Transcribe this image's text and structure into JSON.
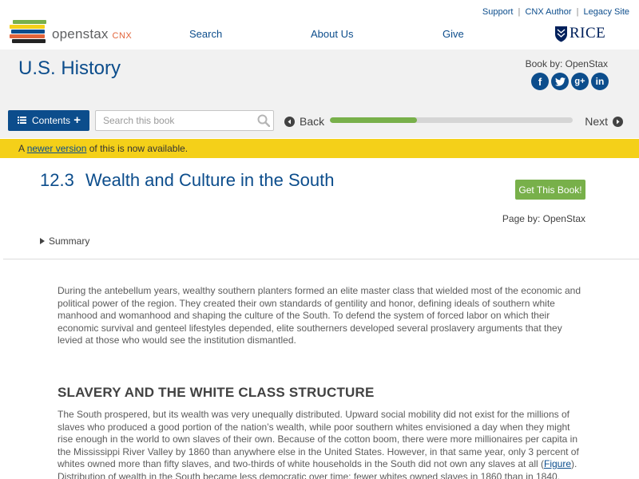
{
  "header": {
    "logo_text": "openstax",
    "logo_suffix": "CNX",
    "util_links": [
      "Support",
      "CNX Author",
      "Legacy Site"
    ],
    "nav": [
      "Search",
      "About Us",
      "Give"
    ],
    "partner_logo": "RICE",
    "logo_colors": [
      "#f4d019",
      "#78b04a",
      "#0c4d8c",
      "#e2643a",
      "#232323"
    ]
  },
  "book": {
    "title": "U.S. History",
    "book_by": "Book by: OpenStax",
    "social": [
      "f",
      "t",
      "g+",
      "in"
    ],
    "social_icons": [
      "facebook-icon",
      "twitter-icon",
      "google-plus-icon",
      "linkedin-icon"
    ]
  },
  "toolbar": {
    "contents_label": "Contents",
    "search_placeholder": "Search this book",
    "back_label": "Back",
    "next_label": "Next",
    "progress": 0.36
  },
  "notice": {
    "prefix": "A ",
    "link": "newer version",
    "suffix": " of this is now available."
  },
  "section": {
    "number": "12.3",
    "title": "Wealth and Culture in the South",
    "get_book": "Get This Book!",
    "page_by": "Page by: OpenStax",
    "summary": "Summary"
  },
  "content": {
    "intro": "During the antebellum years, wealthy southern planters formed an elite master class that wielded most of the economic and political power of the region. They created their own standards of gentility and honor, defining ideals of southern white manhood and womanhood and shaping the culture of the South. To defend the system of forced labor on which their economic survival and genteel lifestyles depended, elite southerners developed several proslavery arguments that they levied at those who would see the institution dismantled.",
    "heading": "SLAVERY AND THE WHITE CLASS STRUCTURE",
    "p2_a": "The South prospered, but its wealth was very unequally distributed. Upward social mobility did not exist for the millions of slaves who produced a good portion of the nation’s wealth, while poor southern whites envisioned a day when they might rise enough in the world to own slaves of their own. Because of the cotton boom, there were more millionaires per capita in the Mississippi River Valley by 1860 than anywhere else in the United States. However, in that same year, only 3 percent of whites owned more than fifty slaves, and two-thirds of white households in the South did not own any slaves at all (",
    "p2_link": "Figure",
    "p2_b": "). Distribution of wealth in the South became less democratic over time; fewer whites owned slaves in 1860 than in 1840."
  }
}
